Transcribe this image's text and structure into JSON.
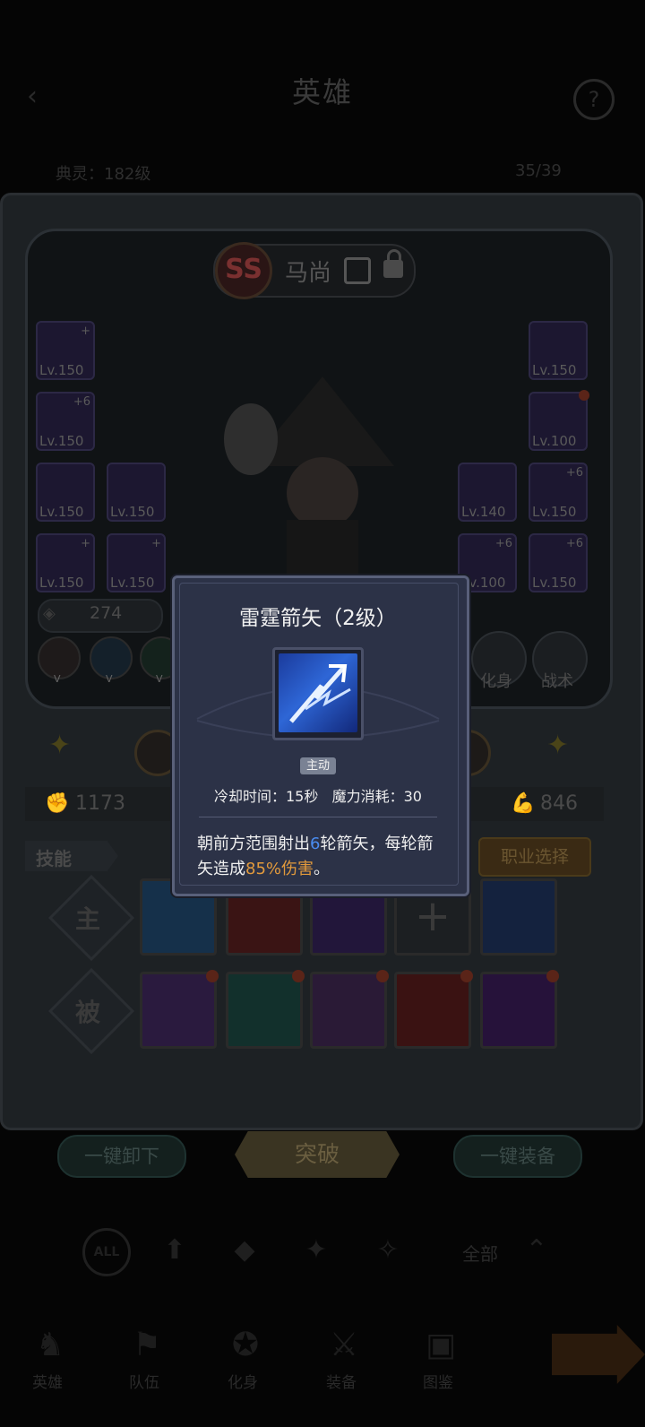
{
  "header": {
    "title": "英雄",
    "level_label": "典灵：182级",
    "count": "35/39"
  },
  "hero": {
    "rank": "SS",
    "name": "马尚",
    "power": "274",
    "left_slots": [
      "Lv.150",
      "Lv.150",
      "Lv.150",
      "Lv.150",
      "Lv.150",
      "Lv.150"
    ],
    "right_slots": [
      "Lv.150",
      "Lv.100",
      "Lv.140",
      "Lv.150",
      "Lv.100",
      "Lv.150"
    ],
    "right_plus": [
      "",
      "",
      "",
      "+6",
      "+6",
      "+6"
    ],
    "left_plus": [
      "+",
      "+6",
      "",
      "",
      "+",
      "+"
    ],
    "round_badge": "V",
    "form_label": "化身",
    "tactic_label": "战术"
  },
  "stats": {
    "attack": "1173",
    "defense": "846"
  },
  "skills": {
    "tab_label": "技能",
    "job_button": "职业选择",
    "active_label": "主",
    "passive_label": "被",
    "empty_slot": "+"
  },
  "actions": {
    "unequip_all": "一键卸下",
    "breakthrough": "突破",
    "equip_all": "一键装备"
  },
  "filter": {
    "all_icon": "ALL",
    "all_label": "全部"
  },
  "nav": [
    "英雄",
    "队伍",
    "化身",
    "装备",
    "图鉴"
  ],
  "popup": {
    "title": "雷霆箭矢（2级）",
    "type_badge": "主动",
    "cooldown": "冷却时间：15秒",
    "mana": "魔力消耗：30",
    "desc_part1": "朝前方范围射出",
    "desc_num": "6",
    "desc_part2": "轮箭矢，每轮箭矢造成",
    "desc_pct": "85%伤害",
    "desc_end": "。"
  },
  "colors": {
    "popup_bg": "#2c3247",
    "highlight_blue": "#4a8cf0",
    "highlight_orange": "#e29a3c"
  }
}
